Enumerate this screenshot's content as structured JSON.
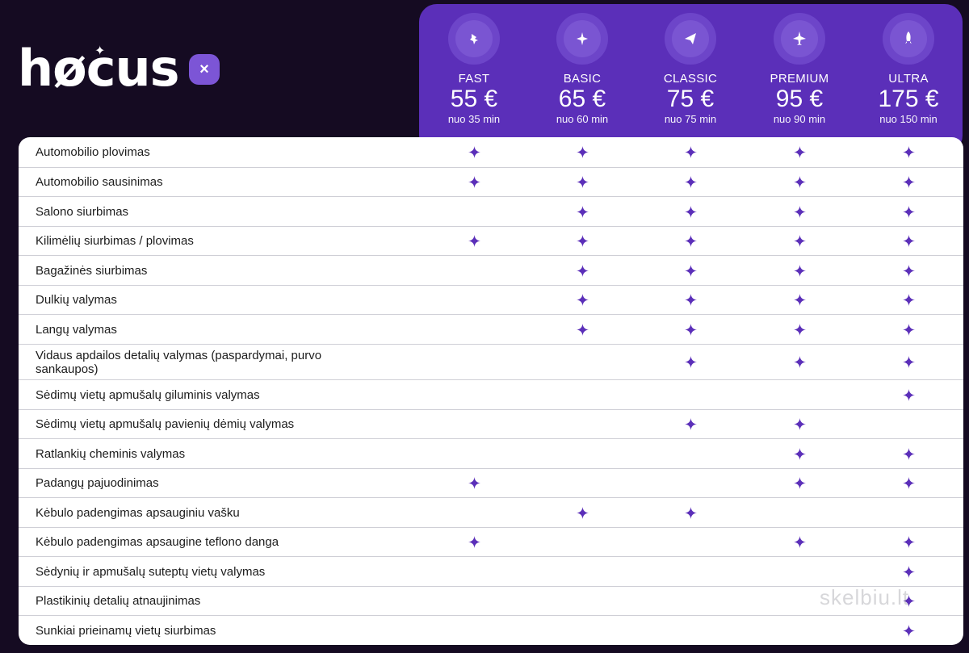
{
  "brand": {
    "name": "høcus",
    "badge_symbol": "×",
    "accent": "#7c55d6"
  },
  "colors": {
    "background": "#150b22",
    "header": "#5b2fb9",
    "check": "#5b2fb9"
  },
  "plans": [
    {
      "name": "FAST",
      "price": "55 €",
      "duration": "nuo 35 min",
      "icon": "car-wash-icon"
    },
    {
      "name": "BASIC",
      "price": "65 €",
      "duration": "nuo 60 min",
      "icon": "airplane-icon"
    },
    {
      "name": "CLASSIC",
      "price": "75 €",
      "duration": "nuo 75 min",
      "icon": "paper-plane-icon"
    },
    {
      "name": "PREMIUM",
      "price": "95 €",
      "duration": "nuo 90 min",
      "icon": "jet-icon"
    },
    {
      "name": "ULTRA",
      "price": "175 €",
      "duration": "nuo 150 min",
      "icon": "rocket-icon"
    }
  ],
  "features": [
    {
      "label": "Automobilio plovimas",
      "included": [
        true,
        true,
        true,
        true,
        true
      ]
    },
    {
      "label": "Automobilio sausinimas",
      "included": [
        true,
        true,
        true,
        true,
        true
      ]
    },
    {
      "label": "Salono siurbimas",
      "included": [
        false,
        true,
        true,
        true,
        true
      ]
    },
    {
      "label": "Kilimėlių siurbimas / plovimas",
      "included": [
        true,
        true,
        true,
        true,
        true
      ]
    },
    {
      "label": "Bagažinės siurbimas",
      "included": [
        false,
        true,
        true,
        true,
        true
      ]
    },
    {
      "label": "Dulkių valymas",
      "included": [
        false,
        true,
        true,
        true,
        true
      ]
    },
    {
      "label": "Langų valymas",
      "included": [
        false,
        true,
        true,
        true,
        true
      ]
    },
    {
      "label": "Vidaus apdailos detalių valymas (paspardymai, purvo sankaupos)",
      "included": [
        false,
        false,
        true,
        true,
        true
      ]
    },
    {
      "label": "Sėdimų vietų apmušalų giluminis valymas",
      "included": [
        false,
        false,
        false,
        false,
        true
      ]
    },
    {
      "label": "Sėdimų vietų apmušalų pavienių dėmių valymas",
      "included": [
        false,
        false,
        true,
        true,
        false
      ]
    },
    {
      "label": "Ratlankių cheminis valymas",
      "included": [
        false,
        false,
        false,
        true,
        true
      ]
    },
    {
      "label": "Padangų pajuodinimas",
      "included": [
        true,
        false,
        false,
        true,
        true
      ]
    },
    {
      "label": "Kėbulo padengimas apsauginiu vašku",
      "included": [
        false,
        true,
        true,
        false,
        false
      ]
    },
    {
      "label": "Kėbulo padengimas apsaugine teflono danga",
      "included": [
        true,
        false,
        false,
        true,
        true
      ]
    },
    {
      "label": "Sėdynių ir apmušalų suteptų vietų valymas",
      "included": [
        false,
        false,
        false,
        false,
        true
      ]
    },
    {
      "label": "Plastikinių detalių atnaujinimas",
      "included": [
        false,
        false,
        false,
        false,
        true
      ]
    },
    {
      "label": "Sunkiai prieinamų vietų siurbimas",
      "included": [
        false,
        false,
        false,
        false,
        true
      ]
    }
  ],
  "watermark": "skelbiu.lt"
}
